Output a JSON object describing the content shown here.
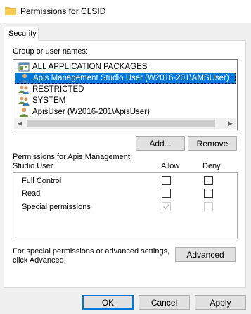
{
  "window": {
    "title": "Permissions for CLSID"
  },
  "tabs": [
    {
      "label": "Security"
    }
  ],
  "group_list": {
    "label": "Group or user names:",
    "items": [
      {
        "name": "ALL APPLICATION PACKAGES",
        "icon": "app-packages-icon",
        "selected": false
      },
      {
        "name": "Apis Management Studio User (W2016-201\\AMSUser)",
        "icon": "user-icon",
        "selected": true
      },
      {
        "name": "RESTRICTED",
        "icon": "group-icon",
        "selected": false
      },
      {
        "name": "SYSTEM",
        "icon": "group-icon",
        "selected": false
      },
      {
        "name": "ApisUser (W2016-201\\ApisUser)",
        "icon": "user-icon",
        "selected": false
      }
    ]
  },
  "buttons": {
    "add": "Add...",
    "remove": "Remove",
    "advanced": "Advanced",
    "ok": "OK",
    "cancel": "Cancel",
    "apply": "Apply"
  },
  "permissions": {
    "header_line1": "Permissions for Apis Management",
    "header_line2": "Studio User",
    "allow_label": "Allow",
    "deny_label": "Deny",
    "rows": [
      {
        "name": "Full Control",
        "allow": false,
        "deny": false,
        "disabled": false
      },
      {
        "name": "Read",
        "allow": false,
        "deny": false,
        "disabled": false
      },
      {
        "name": "Special permissions",
        "allow": true,
        "deny": false,
        "disabled": true
      }
    ]
  },
  "advanced_note": {
    "line1": "For special permissions or advanced settings,",
    "line2": "click Advanced."
  },
  "colors": {
    "selection": "#0078d7",
    "default_button_border": "#0078d7",
    "dialog_background": "#f0f0f0"
  }
}
